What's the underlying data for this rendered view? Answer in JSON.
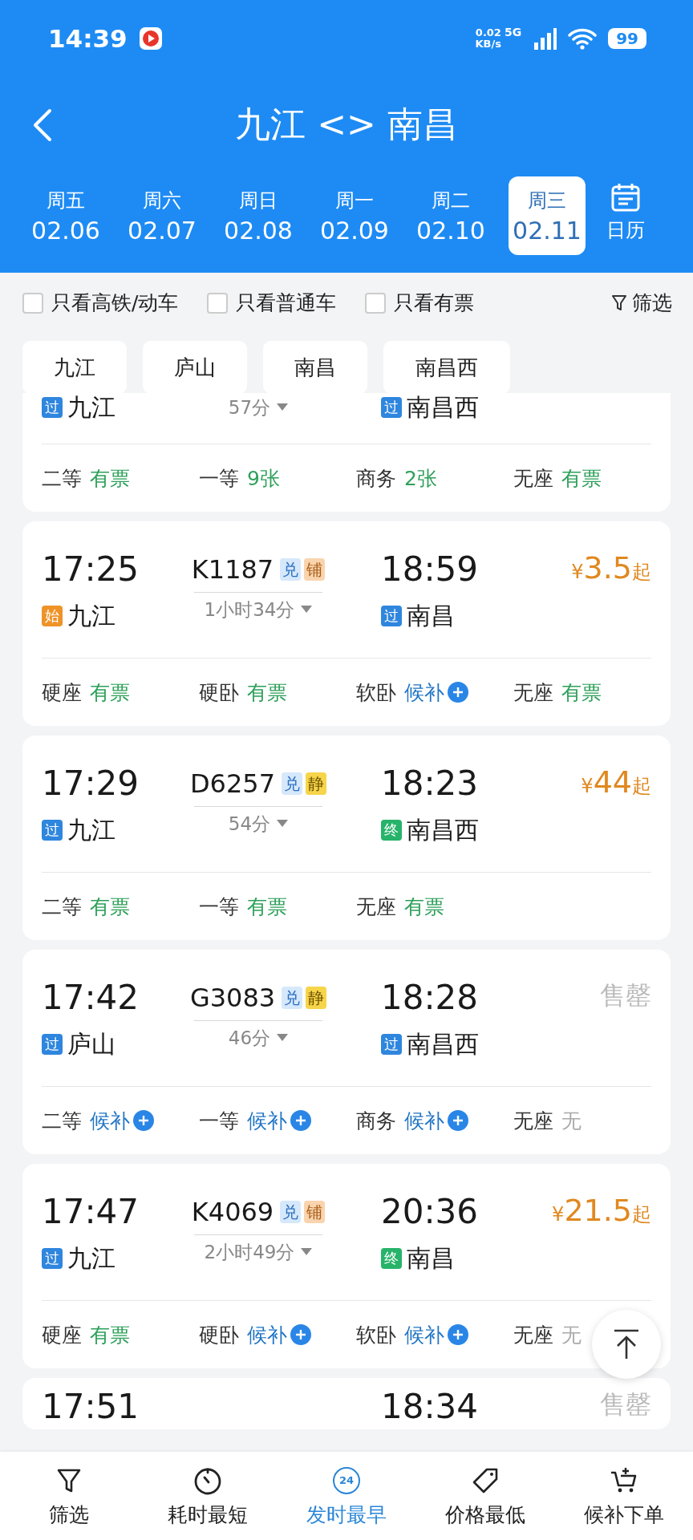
{
  "status_bar": {
    "time": "14:39",
    "net_speed": "0.02",
    "net_unit": "KB/s",
    "network": "5G",
    "battery": "99"
  },
  "header": {
    "title": "九江 <> 南昌"
  },
  "dates": [
    {
      "weekday": "周五",
      "date": "02.06",
      "selected": false
    },
    {
      "weekday": "周六",
      "date": "02.07",
      "selected": false
    },
    {
      "weekday": "周日",
      "date": "02.08",
      "selected": false
    },
    {
      "weekday": "周一",
      "date": "02.09",
      "selected": false
    },
    {
      "weekday": "周二",
      "date": "02.10",
      "selected": false
    },
    {
      "weekday": "周三",
      "date": "02.11",
      "selected": true
    }
  ],
  "calendar_label": "日历",
  "filters": [
    {
      "label": "只看高铁/动车",
      "checked": false
    },
    {
      "label": "只看普通车",
      "checked": false
    },
    {
      "label": "只看有票",
      "checked": false
    }
  ],
  "filter_button": "筛选",
  "stations": [
    "九江",
    "庐山",
    "南昌",
    "南昌西"
  ],
  "trains": [
    {
      "kind": "partial_top",
      "from": {
        "tag": "过",
        "color": "#2f86de",
        "station": "九江"
      },
      "duration": "57分",
      "to": {
        "tag": "过",
        "color": "#2f86de",
        "station": "南昌西"
      },
      "seats": [
        {
          "class": "二等",
          "status": "有票",
          "kind": "available"
        },
        {
          "class": "一等",
          "status": "9张",
          "kind": "available"
        },
        {
          "class": "商务",
          "status": "2张",
          "kind": "available"
        },
        {
          "class": "无座",
          "status": "有票",
          "kind": "available"
        }
      ]
    },
    {
      "kind": "full",
      "depart": "17:25",
      "number": "K1187",
      "badges": [
        {
          "text": "兑",
          "kind": "exchange"
        },
        {
          "text": "铺",
          "kind": "berth"
        }
      ],
      "arrive": "18:59",
      "price": {
        "kind": "price",
        "currency": "¥",
        "amount": "3.5",
        "suffix": "起"
      },
      "from": {
        "tag": "始",
        "color": "#ef9328",
        "station": "九江"
      },
      "duration": "1小时34分",
      "to": {
        "tag": "过",
        "color": "#2f86de",
        "station": "南昌"
      },
      "seats": [
        {
          "class": "硬座",
          "status": "有票",
          "kind": "available"
        },
        {
          "class": "硬卧",
          "status": "有票",
          "kind": "available"
        },
        {
          "class": "软卧",
          "status": "候补",
          "kind": "waitlist"
        },
        {
          "class": "无座",
          "status": "有票",
          "kind": "available"
        }
      ]
    },
    {
      "kind": "full",
      "depart": "17:29",
      "number": "D6257",
      "badges": [
        {
          "text": "兑",
          "kind": "exchange"
        },
        {
          "text": "静",
          "kind": "quiet"
        }
      ],
      "arrive": "18:23",
      "price": {
        "kind": "price",
        "currency": "¥",
        "amount": "44",
        "suffix": "起"
      },
      "from": {
        "tag": "过",
        "color": "#2f86de",
        "station": "九江"
      },
      "duration": "54分",
      "to": {
        "tag": "终",
        "color": "#27b36a",
        "station": "南昌西"
      },
      "seats": [
        {
          "class": "二等",
          "status": "有票",
          "kind": "available"
        },
        {
          "class": "一等",
          "status": "有票",
          "kind": "available"
        },
        {
          "class": "无座",
          "status": "有票",
          "kind": "available"
        }
      ]
    },
    {
      "kind": "full",
      "depart": "17:42",
      "number": "G3083",
      "badges": [
        {
          "text": "兑",
          "kind": "exchange"
        },
        {
          "text": "静",
          "kind": "quiet"
        }
      ],
      "arrive": "18:28",
      "price": {
        "kind": "sold_out",
        "text": "售罄"
      },
      "from": {
        "tag": "过",
        "color": "#2f86de",
        "station": "庐山"
      },
      "duration": "46分",
      "to": {
        "tag": "过",
        "color": "#2f86de",
        "station": "南昌西"
      },
      "seats": [
        {
          "class": "二等",
          "status": "候补",
          "kind": "waitlist"
        },
        {
          "class": "一等",
          "status": "候补",
          "kind": "waitlist"
        },
        {
          "class": "商务",
          "status": "候补",
          "kind": "waitlist"
        },
        {
          "class": "无座",
          "status": "无",
          "kind": "none"
        }
      ]
    },
    {
      "kind": "full",
      "depart": "17:47",
      "number": "K4069",
      "badges": [
        {
          "text": "兑",
          "kind": "exchange"
        },
        {
          "text": "铺",
          "kind": "berth"
        }
      ],
      "arrive": "20:36",
      "price": {
        "kind": "price",
        "currency": "¥",
        "amount": "21.5",
        "suffix": "起"
      },
      "from": {
        "tag": "过",
        "color": "#2f86de",
        "station": "九江"
      },
      "duration": "2小时49分",
      "to": {
        "tag": "终",
        "color": "#27b36a",
        "station": "南昌"
      },
      "seats": [
        {
          "class": "硬座",
          "status": "有票",
          "kind": "available"
        },
        {
          "class": "硬卧",
          "status": "候补",
          "kind": "waitlist"
        },
        {
          "class": "软卧",
          "status": "候补",
          "kind": "waitlist"
        },
        {
          "class": "无座",
          "status": "无",
          "kind": "none"
        }
      ]
    },
    {
      "kind": "partial_bottom",
      "depart": "17:51",
      "arrive": "18:34",
      "price": {
        "kind": "sold_out",
        "text": "售罄"
      }
    }
  ],
  "bottom_nav": [
    {
      "label": "筛选",
      "selected": false
    },
    {
      "label": "耗时最短",
      "selected": false
    },
    {
      "label": "发时最早",
      "icon_text": "24",
      "selected": true
    },
    {
      "label": "价格最低",
      "selected": false
    },
    {
      "label": "候补下单",
      "selected": false
    }
  ]
}
